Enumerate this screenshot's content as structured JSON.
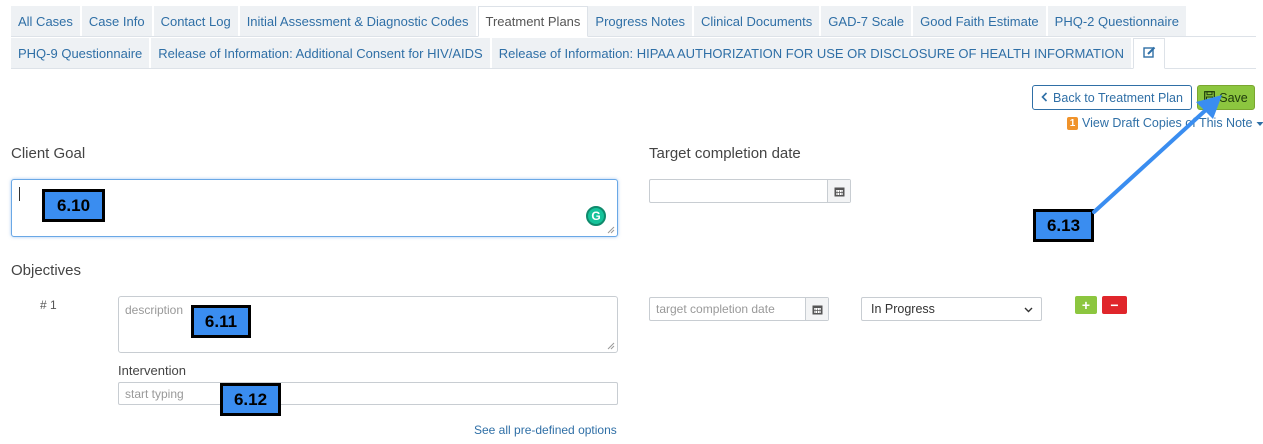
{
  "tabs": {
    "row1": [
      "All Cases",
      "Case Info",
      "Contact Log",
      "Initial Assessment & Diagnostic Codes",
      "Treatment Plans",
      "Progress Notes",
      "Clinical Documents",
      "GAD-7 Scale",
      "Good Faith Estimate",
      "PHQ-2 Questionnaire"
    ],
    "row2": [
      "PHQ-9 Questionnaire",
      "Release of Information: Additional Consent for HIV/AIDS",
      "Release of Information: HIPAA AUTHORIZATION FOR USE OR DISCLOSURE OF HEALTH INFORMATION"
    ],
    "active": "Treatment Plans",
    "edit_icon": "edit-icon"
  },
  "toolbar": {
    "back_label": "Back to Treatment Plan",
    "save_label": "Save",
    "drafts_count": "1",
    "drafts_label": "View Draft Copies of This Note"
  },
  "form": {
    "client_goal_label": "Client Goal",
    "client_goal_value": "",
    "target_date_label": "Target completion date",
    "objectives_label": "Objectives",
    "objective": {
      "number": "# 1",
      "description_placeholder": "description",
      "target_date_placeholder": "target completion date",
      "status_value": "In Progress",
      "intervention_label": "Intervention",
      "intervention_placeholder": "start typing",
      "see_all_label": "See all pre-defined options"
    }
  },
  "annotations": {
    "a1": "6.10",
    "a2": "6.11",
    "a3": "6.12",
    "a4": "6.13"
  },
  "colors": {
    "link": "#2f6fa6",
    "save": "#8cc63f",
    "remove": "#e0262b",
    "badge": "#3a8df0",
    "arrow": "#3a8df0"
  }
}
